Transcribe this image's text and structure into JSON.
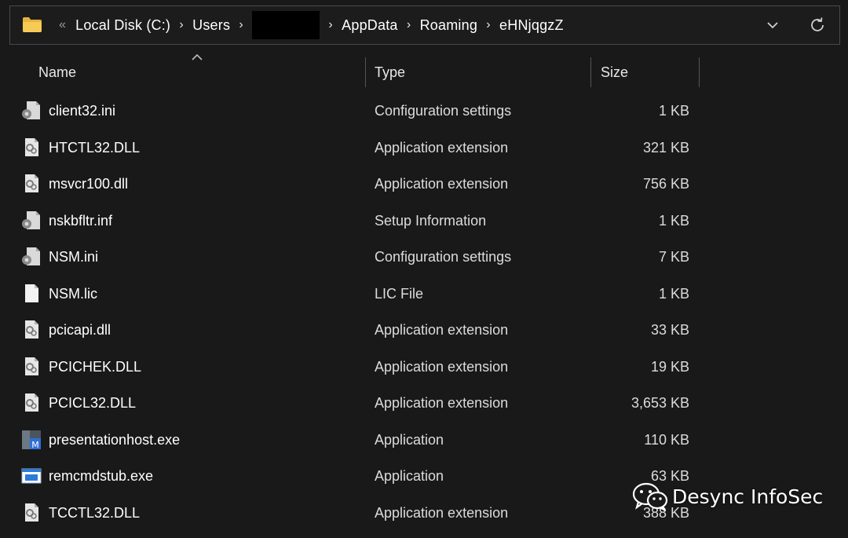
{
  "address_bar": {
    "overflow_glyph": "«",
    "crumbs": [
      "Local Disk (C:)",
      "Users",
      "",
      "AppData",
      "Roaming",
      "eHNjqgzZ"
    ],
    "separator": "›",
    "folder_icon": "folder-icon",
    "dropdown_icon": "chevron-down-icon",
    "refresh_icon": "refresh-icon"
  },
  "columns": {
    "name": "Name",
    "type": "Type",
    "size": "Size",
    "sort_indicator": "sort-ascending-icon"
  },
  "files": [
    {
      "name": "client32.ini",
      "type": "Configuration settings",
      "size": "1 KB",
      "icon": "settings-file-icon"
    },
    {
      "name": "HTCTL32.DLL",
      "type": "Application extension",
      "size": "321 KB",
      "icon": "dll-file-icon"
    },
    {
      "name": "msvcr100.dll",
      "type": "Application extension",
      "size": "756 KB",
      "icon": "dll-file-icon"
    },
    {
      "name": "nskbfltr.inf",
      "type": "Setup Information",
      "size": "1 KB",
      "icon": "settings-file-icon"
    },
    {
      "name": "NSM.ini",
      "type": "Configuration settings",
      "size": "7 KB",
      "icon": "settings-file-icon"
    },
    {
      "name": "NSM.lic",
      "type": "LIC File",
      "size": "1 KB",
      "icon": "blank-file-icon"
    },
    {
      "name": "pcicapi.dll",
      "type": "Application extension",
      "size": "33 KB",
      "icon": "dll-file-icon"
    },
    {
      "name": "PCICHEK.DLL",
      "type": "Application extension",
      "size": "19 KB",
      "icon": "dll-file-icon"
    },
    {
      "name": "PCICL32.DLL",
      "type": "Application extension",
      "size": "3,653 KB",
      "icon": "dll-file-icon"
    },
    {
      "name": "presentationhost.exe",
      "type": "Application",
      "size": "110 KB",
      "icon": "netsupport-app-icon"
    },
    {
      "name": "remcmdstub.exe",
      "type": "Application",
      "size": "63 KB",
      "icon": "window-app-icon"
    },
    {
      "name": "TCCTL32.DLL",
      "type": "Application extension",
      "size": "388 KB",
      "icon": "dll-file-icon"
    }
  ],
  "watermark": {
    "text": "Desync InfoSec",
    "logo": "wechat-logo-icon"
  },
  "colors": {
    "background": "#191919",
    "folder": "#f2c54a",
    "text": "#ffffff",
    "muted_text": "#dcdcdc"
  }
}
